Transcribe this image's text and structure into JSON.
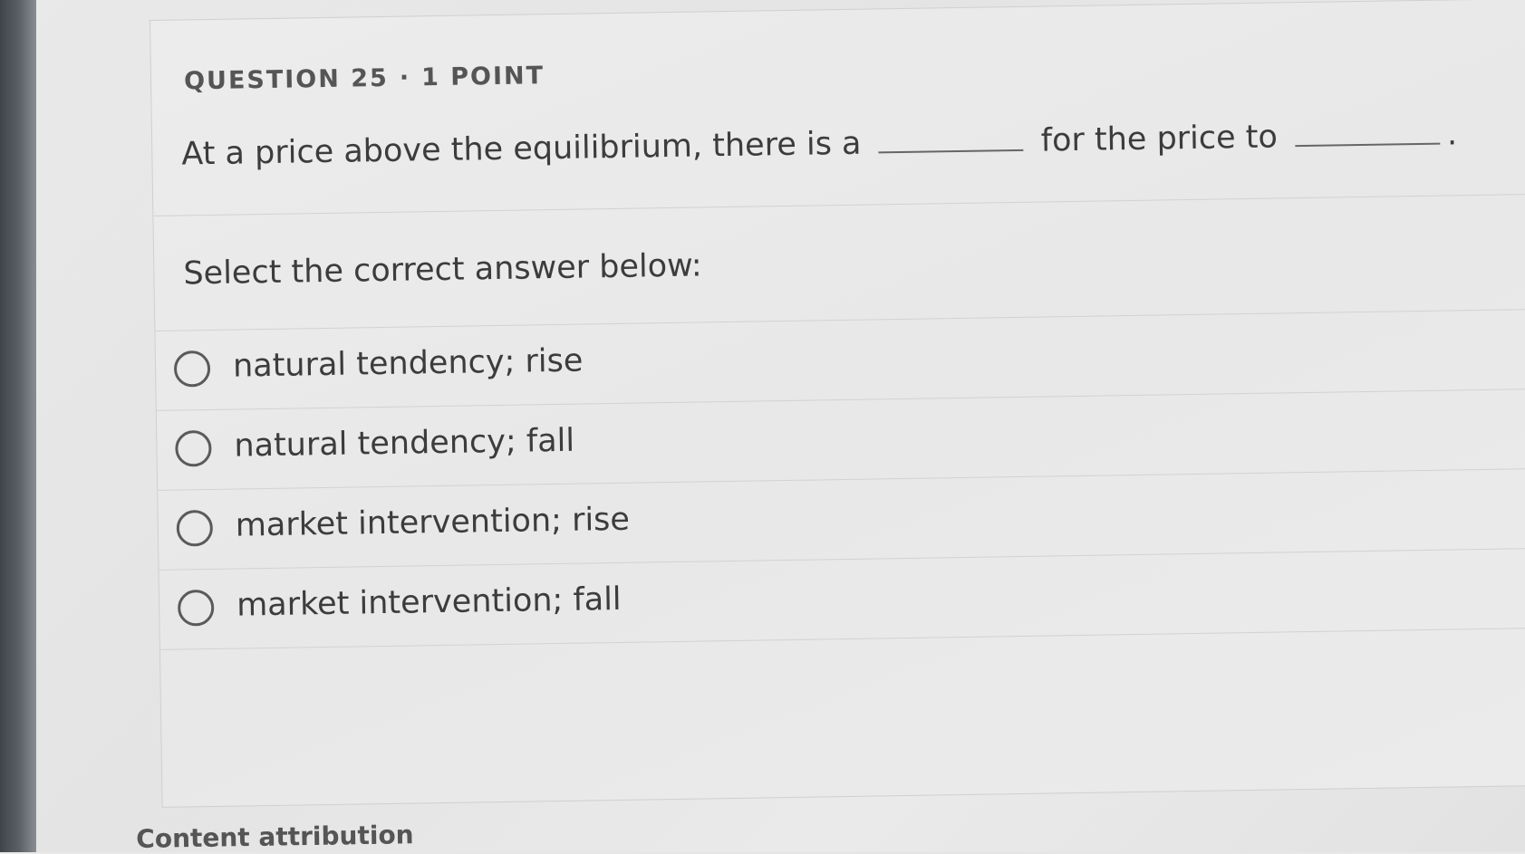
{
  "question": {
    "label": "QUESTION 25",
    "separator": "·",
    "points": "1 POINT",
    "prompt_part1": "At a price above the equilibrium, there is a",
    "prompt_part2": "for the price to",
    "prompt_end": "."
  },
  "instruction": "Select the correct answer below:",
  "options": [
    {
      "label": "natural tendency; rise"
    },
    {
      "label": "natural tendency; fall"
    },
    {
      "label": "market intervention; rise"
    },
    {
      "label": "market intervention; fall"
    }
  ],
  "footer": {
    "attribution": "Content attribution"
  },
  "colors": {
    "background": "#e8e8e8",
    "text": "#3c3c3c",
    "radio_border": "#5a5a5a"
  }
}
